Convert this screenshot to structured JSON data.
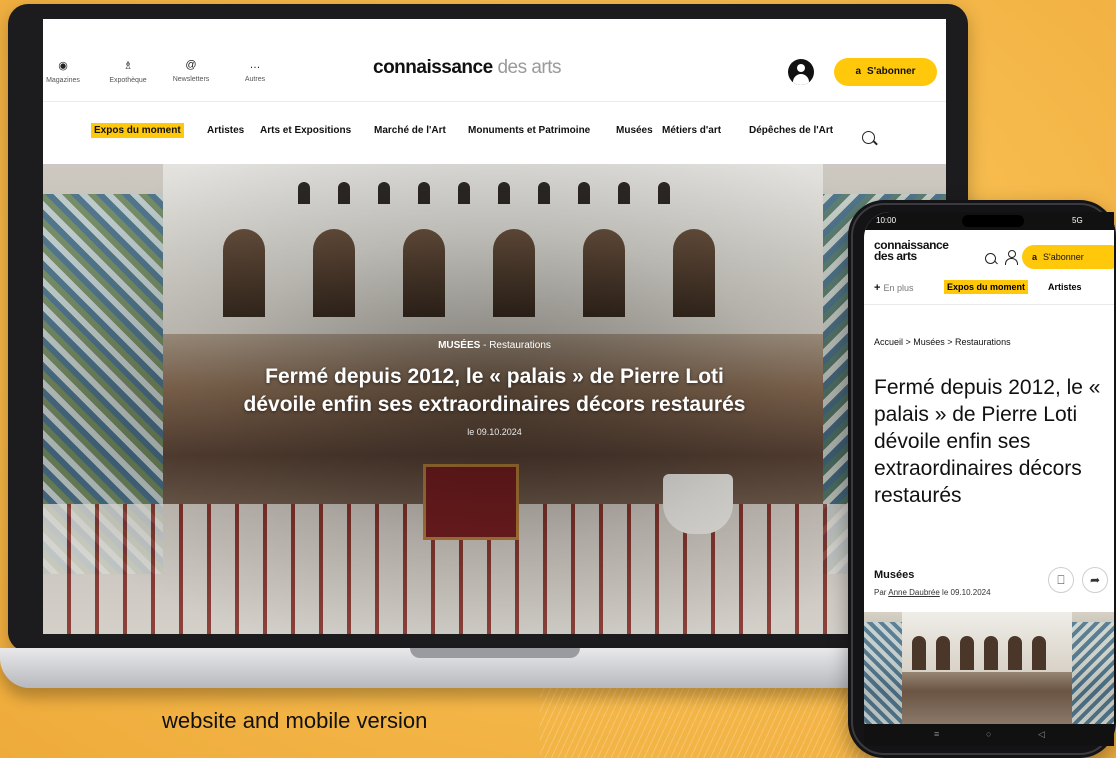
{
  "desktop": {
    "toolbar": [
      {
        "icon": "eye-icon",
        "glyph": "◉",
        "label": "Magazines"
      },
      {
        "icon": "library-icon",
        "glyph": "♗",
        "label": "Expothèque"
      },
      {
        "icon": "at-icon",
        "glyph": "@",
        "label": "Newsletters"
      },
      {
        "icon": "more-icon",
        "glyph": "…",
        "label": "Autres"
      }
    ],
    "logo": {
      "bold": "connaissance",
      "light": "des arts"
    },
    "subscribe": {
      "glyph": "a",
      "label": "S'abonner"
    },
    "nav": [
      "Expos du moment",
      "Artistes",
      "Arts et Expositions",
      "Marché de l'Art",
      "Monuments et Patrimoine",
      "Musées",
      "Métiers d'art",
      "Dépêches de l'Art"
    ],
    "hero": {
      "category": "MUSÉES",
      "subcategory": " - Restaurations",
      "title_line1": "Fermé depuis 2012, le « palais » de Pierre Loti",
      "title_line2": "dévoile enfin ses extraordinaires décors restaurés",
      "date": "le 09.10.2024"
    }
  },
  "mobile": {
    "status_left": "10:00",
    "status_right": "5G",
    "logo_line1": "connaissance",
    "logo_line2": "des arts",
    "subscribe": {
      "glyph": "a",
      "label": "S'abonner"
    },
    "more_label": "En plus",
    "tab_active": "Expos du moment",
    "tab_next": "Artistes",
    "breadcrumb": "Accueil  >  Musées  >  Restaurations",
    "title": "Fermé depuis 2012, le « palais » de Pierre Loti dévoile enfin ses extraordinaires décors restaurés",
    "category": "Musées",
    "author_prefix": "Par ",
    "author": "Anne Daubrée",
    "author_date": " le 09.10.2024",
    "bookmark_glyph": "⎕",
    "share_glyph": "➦"
  },
  "caption": "website and mobile version"
}
